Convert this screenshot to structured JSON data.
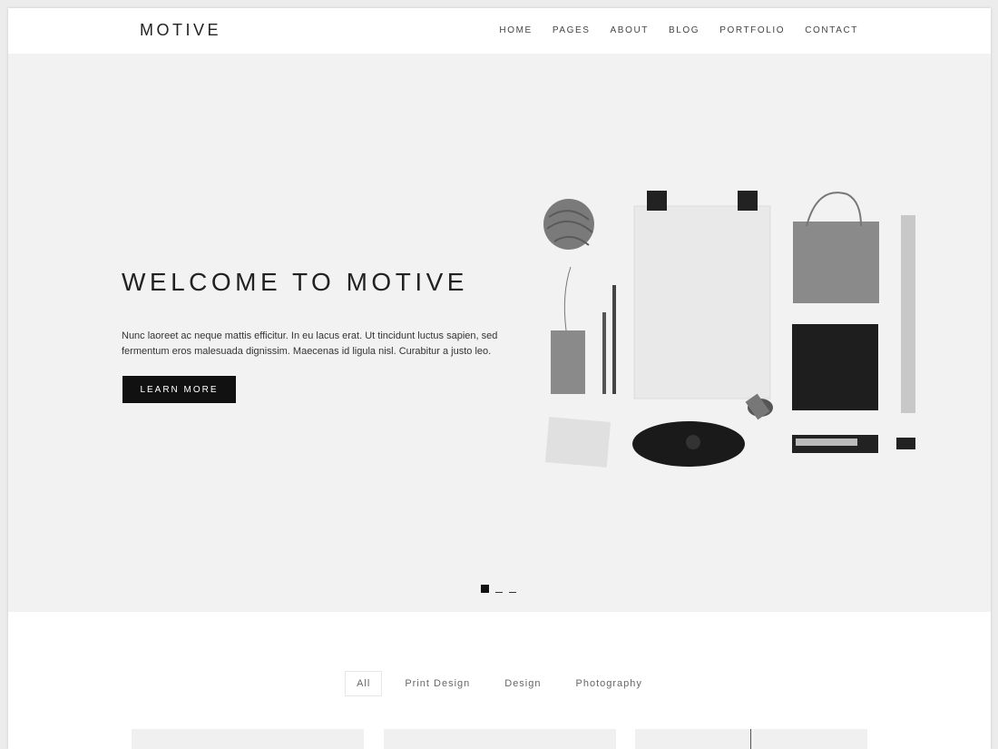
{
  "brand": {
    "logo": "MOTIVE"
  },
  "nav": {
    "items": [
      {
        "label": "HOME",
        "name": "nav-home"
      },
      {
        "label": "PAGES",
        "name": "nav-pages"
      },
      {
        "label": "ABOUT",
        "name": "nav-about"
      },
      {
        "label": "BLOG",
        "name": "nav-blog"
      },
      {
        "label": "PORTFOLIO",
        "name": "nav-portfolio"
      },
      {
        "label": "CONTACT",
        "name": "nav-contact"
      }
    ]
  },
  "hero": {
    "title": "WELCOME TO MOTIVE",
    "text": "Nunc laoreet ac neque mattis efficitur. In eu lacus erat. Ut tincidunt luctus sapien, sed fermentum eros malesuada dignissim. Maecenas id ligula nisl. Curabitur a justo leo.",
    "button_label": "LEARN MORE",
    "slides_total": 3,
    "slide_active": 1
  },
  "filters": {
    "items": [
      "All",
      "Print Design",
      "Design",
      "Photography"
    ],
    "active": "All"
  },
  "colors": {
    "hero_bg": "#f2f2f2",
    "button_bg": "#111111",
    "text": "#222222"
  }
}
